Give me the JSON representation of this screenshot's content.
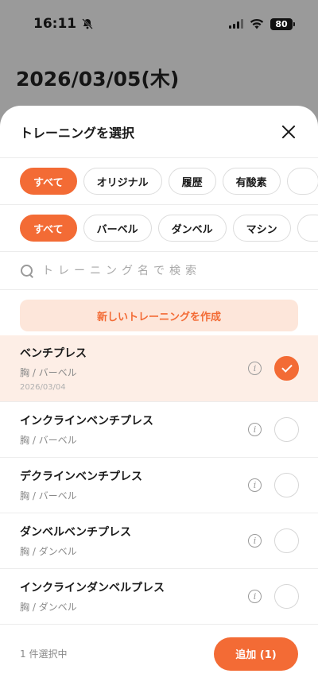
{
  "status_bar": {
    "time": "16:11",
    "battery": "80",
    "icons": [
      "bell-off-icon",
      "signal-icon",
      "wifi-icon",
      "battery-icon"
    ]
  },
  "background": {
    "date": "2026/03/05(木)"
  },
  "sheet": {
    "title": "トレーニングを選択",
    "close_icon": "close-icon",
    "source_filters": [
      {
        "label": "すべて",
        "active": true
      },
      {
        "label": "オリジナル",
        "active": false
      },
      {
        "label": "履歴",
        "active": false
      },
      {
        "label": "有酸素",
        "active": false
      }
    ],
    "equipment_filters": [
      {
        "label": "すべて",
        "active": true
      },
      {
        "label": "バーベル",
        "active": false
      },
      {
        "label": "ダンベル",
        "active": false
      },
      {
        "label": "マシン",
        "active": false
      }
    ],
    "search": {
      "placeholder": "トレーニング名で検索",
      "value": ""
    },
    "create_label": "新しいトレーニングを作成",
    "items": [
      {
        "name": "ベンチプレス",
        "category": "胸 / バーベル",
        "date": "2026/03/04",
        "selected": true
      },
      {
        "name": "インクラインベンチプレス",
        "category": "胸 / バーベル",
        "selected": false
      },
      {
        "name": "デクラインベンチプレス",
        "category": "胸 / バーベル",
        "selected": false
      },
      {
        "name": "ダンベルベンチプレス",
        "category": "胸 / ダンベル",
        "selected": false
      },
      {
        "name": "インクラインダンベルプレス",
        "category": "胸 / ダンベル",
        "selected": false
      }
    ],
    "footer": {
      "count_label": "1 件選択中",
      "add_label": "追加 (1)"
    }
  },
  "colors": {
    "accent": "#f36b35",
    "accent_light": "#fde6da",
    "selected_row": "#fdeee6"
  }
}
